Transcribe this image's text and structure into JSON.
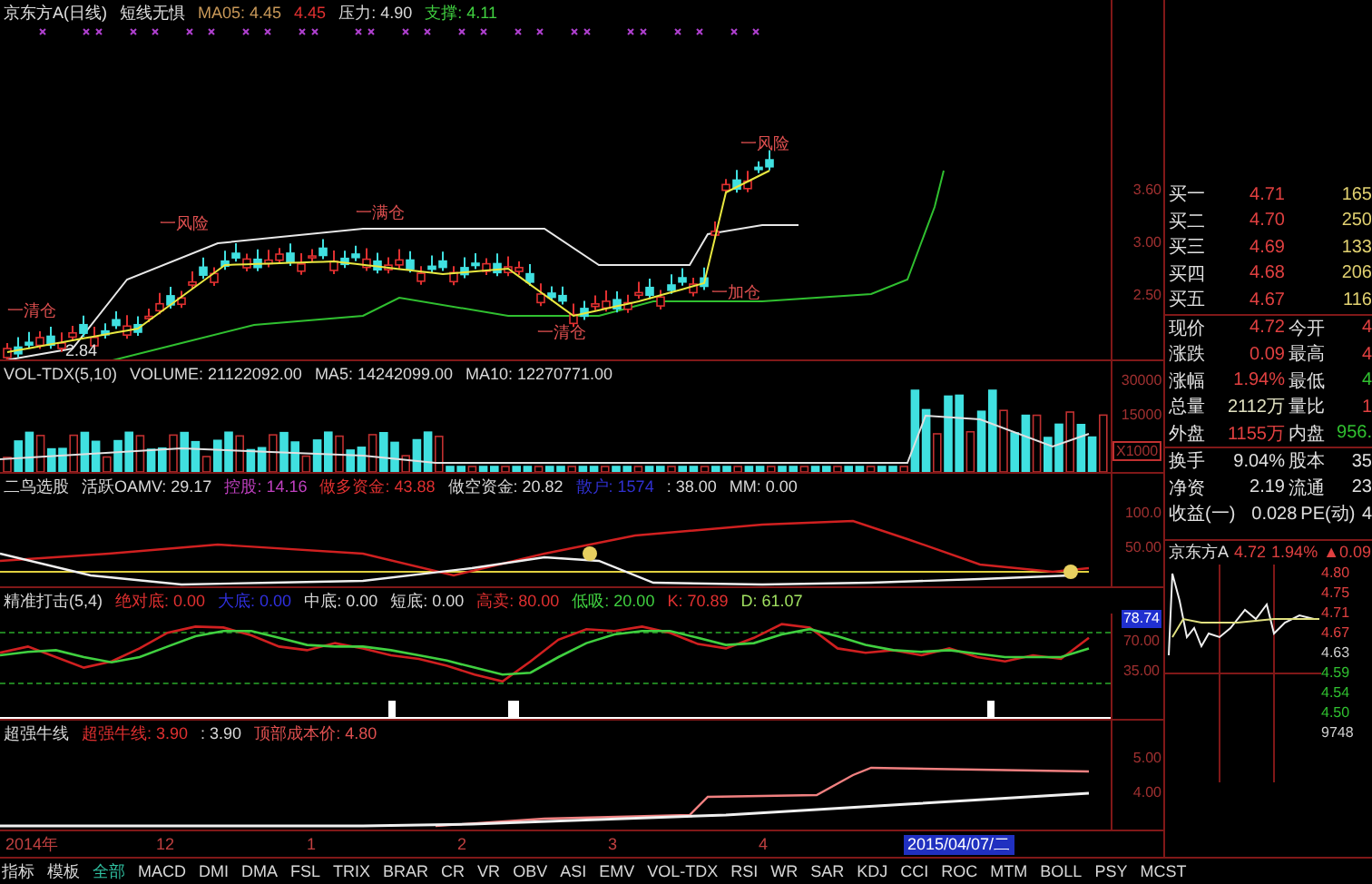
{
  "price_panel": {
    "title": "京东方A(日线)",
    "indicator": "短线无惧",
    "readings": [
      {
        "text": "MA05: 4.45",
        "color": "#c89858"
      },
      {
        "text": "4.45",
        "color": "#e03030"
      },
      {
        "text": "压力: 4.90",
        "color": "#d8d8d8"
      },
      {
        "text": "支撑: 4.11",
        "color": "#40d040"
      }
    ],
    "signals": [
      "一清仓",
      "2.84",
      "一风险",
      "一满仓",
      "一清仓",
      "一加仓",
      "一风险"
    ],
    "axis": [
      "3.60",
      "3.00",
      "2.50"
    ]
  },
  "volume_panel": {
    "readings": [
      {
        "text": "VOL-TDX(5,10)",
        "color": "#d8d8d8"
      },
      {
        "text": "VOLUME: 21122092.00",
        "color": "#d8d8d8"
      },
      {
        "text": "MA5: 14242099.00",
        "color": "#d8d8d8"
      },
      {
        "text": "MA10: 12270771.00",
        "color": "#d8d8d8"
      }
    ],
    "axis": [
      "30000",
      "15000",
      "X1000"
    ]
  },
  "oamv_panel": {
    "readings": [
      {
        "text": "二鸟选股",
        "color": "#d8d8d8"
      },
      {
        "text": "活跃OAMV: 29.17",
        "color": "#d8d8d8"
      },
      {
        "text": "控股: 14.16",
        "color": "#c040c0"
      },
      {
        "text": "做多资金: 43.88",
        "color": "#e03030"
      },
      {
        "text": "做空资金: 20.82",
        "color": "#d8d8d8"
      },
      {
        "text": "散户: 1574",
        "color": "#3030d0"
      },
      {
        "text": ": 38.00",
        "color": "#d8d8d8"
      },
      {
        "text": "MM: 0.00",
        "color": "#d8d8d8"
      }
    ],
    "axis": [
      "100.0",
      "50.00"
    ]
  },
  "kdj_panel": {
    "readings": [
      {
        "text": "精准打击(5,4)",
        "color": "#d8d8d8"
      },
      {
        "text": "绝对底: 0.00",
        "color": "#e03030"
      },
      {
        "text": "大底: 0.00",
        "color": "#3030e0"
      },
      {
        "text": "中底: 0.00",
        "color": "#d8d8d8"
      },
      {
        "text": "短底: 0.00",
        "color": "#d8d8d8"
      },
      {
        "text": "高卖: 80.00",
        "color": "#e03030"
      },
      {
        "text": "低吸: 20.00",
        "color": "#40d040"
      },
      {
        "text": "K: 70.89",
        "color": "#e03030"
      },
      {
        "text": "D: 61.07",
        "color": "#a0e060"
      }
    ],
    "current_value": "78.74",
    "chart_data": {
      "type": "line",
      "ylim": [
        0,
        100
      ],
      "yticks": [
        {
          "value": 70,
          "label": "70.00"
        },
        {
          "value": 35,
          "label": "35.00"
        }
      ],
      "series": [
        {
          "color": "#d02020",
          "values": [
            55,
            62,
            50,
            38,
            45,
            60,
            78,
            85,
            84,
            75,
            62,
            58,
            66,
            60,
            52,
            48,
            40,
            30,
            22,
            45,
            70,
            82,
            80,
            85,
            78,
            65,
            60,
            72,
            88,
            84,
            60,
            55,
            58,
            52,
            60,
            50,
            45,
            52,
            48,
            72
          ]
        },
        {
          "color": "#40d040",
          "values": [
            52,
            56,
            58,
            50,
            44,
            50,
            62,
            74,
            80,
            80,
            72,
            64,
            62,
            62,
            58,
            52,
            46,
            38,
            30,
            32,
            50,
            66,
            76,
            80,
            80,
            72,
            64,
            66,
            76,
            82,
            74,
            64,
            58,
            56,
            58,
            54,
            50,
            50,
            50,
            60
          ]
        }
      ]
    }
  },
  "bull_panel": {
    "readings": [
      {
        "text": "超强牛线",
        "color": "#d8d8d8"
      },
      {
        "text": "超强牛线: 3.90",
        "color": "#e03030"
      },
      {
        "text": ": 3.90",
        "color": "#d8d8d8"
      },
      {
        "text": "顶部成本价: 4.80",
        "color": "#e05050"
      }
    ],
    "axis": [
      "5.00",
      "4.00"
    ]
  },
  "date_axis": {
    "labels": [
      "2014年",
      "12",
      "1",
      "2",
      "3",
      "4"
    ],
    "current_date": "2015/04/07/二"
  },
  "tabs": [
    {
      "label": "指标",
      "selected": false
    },
    {
      "label": "模板",
      "selected": false
    },
    {
      "label": "全部",
      "selected": true
    },
    {
      "label": "MACD",
      "selected": false
    },
    {
      "label": "DMI",
      "selected": false
    },
    {
      "label": "DMA",
      "selected": false
    },
    {
      "label": "FSL",
      "selected": false
    },
    {
      "label": "TRIX",
      "selected": false
    },
    {
      "label": "BRAR",
      "selected": false
    },
    {
      "label": "CR",
      "selected": false
    },
    {
      "label": "VR",
      "selected": false
    },
    {
      "label": "OBV",
      "selected": false
    },
    {
      "label": "ASI",
      "selected": false
    },
    {
      "label": "EMV",
      "selected": false
    },
    {
      "label": "VOL-TDX",
      "selected": false
    },
    {
      "label": "RSI",
      "selected": false
    },
    {
      "label": "WR",
      "selected": false
    },
    {
      "label": "SAR",
      "selected": false
    },
    {
      "label": "KDJ",
      "selected": false
    },
    {
      "label": "CCI",
      "selected": false
    },
    {
      "label": "ROC",
      "selected": false
    },
    {
      "label": "MTM",
      "selected": false
    },
    {
      "label": "BOLL",
      "selected": false
    },
    {
      "label": "PSY",
      "selected": false
    },
    {
      "label": "MCST",
      "selected": false
    }
  ],
  "quote": {
    "bids": [
      {
        "label": "买一",
        "price": "4.71",
        "volume": "165"
      },
      {
        "label": "买二",
        "price": "4.70",
        "volume": "250"
      },
      {
        "label": "买三",
        "price": "4.69",
        "volume": "133"
      },
      {
        "label": "买四",
        "price": "4.68",
        "volume": "206"
      },
      {
        "label": "买五",
        "price": "4.67",
        "volume": "116"
      }
    ],
    "stats": [
      {
        "left": {
          "label": "现价",
          "value": "4.72",
          "color": "#e04040"
        },
        "right": {
          "label": "今开",
          "value": "4",
          "color": "#e04040"
        }
      },
      {
        "left": {
          "label": "涨跌",
          "value": "0.09",
          "color": "#e04040"
        },
        "right": {
          "label": "最高",
          "value": "4",
          "color": "#e04040"
        }
      },
      {
        "left": {
          "label": "涨幅",
          "value": "1.94%",
          "color": "#e04040"
        },
        "right": {
          "label": "最低",
          "value": "4",
          "color": "#30c030"
        }
      },
      {
        "left": {
          "label": "总量",
          "value": "2112万",
          "color": "#e0e0c0"
        },
        "right": {
          "label": "量比",
          "value": "1",
          "color": "#e04040"
        }
      },
      {
        "left": {
          "label": "外盘",
          "value": "1155万",
          "color": "#e04040"
        },
        "right": {
          "label": "内盘",
          "value": "956.",
          "color": "#30c030"
        }
      },
      {
        "left": {
          "label": "换手",
          "value": "9.04%",
          "color": "#e0e0e0"
        },
        "right": {
          "label": "股本",
          "value": "35",
          "color": "#e0e0e0"
        }
      },
      {
        "left": {
          "label": "净资",
          "value": "2.19",
          "color": "#e0e0e0"
        },
        "right": {
          "label": "流通",
          "value": "23",
          "color": "#e0e0e0"
        }
      },
      {
        "left": {
          "label": "收益(一)",
          "value": "0.028",
          "color": "#e0e0e0"
        },
        "right": {
          "label": "PE(动)",
          "value": "4",
          "color": "#e0e0e0"
        }
      }
    ]
  },
  "intraday": {
    "name": "京东方A",
    "price": "4.72",
    "change_pct": "1.94%",
    "change": "▲0.09",
    "axis": [
      "4.80",
      "4.75",
      "4.71",
      "4.67",
      "4.63",
      "4.59",
      "4.54",
      "4.50",
      "9748"
    ]
  }
}
